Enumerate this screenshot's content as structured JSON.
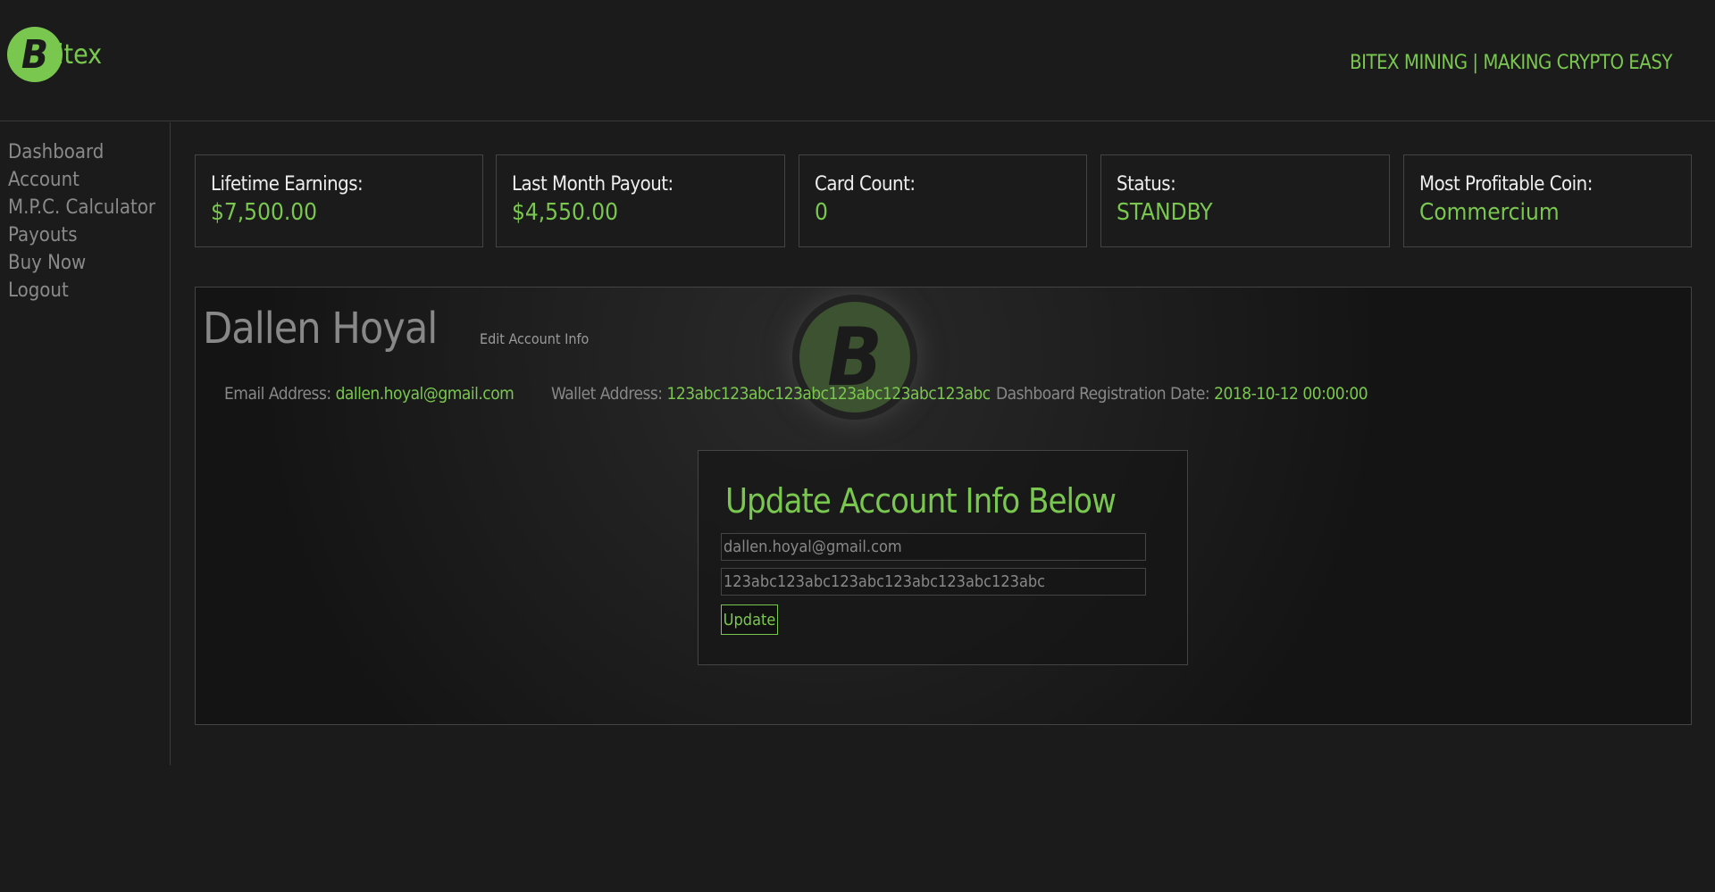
{
  "header": {
    "logo_text": "Bitex",
    "logo_letter": "B",
    "tagline": "BITEX MINING | MAKING CRYPTO EASY"
  },
  "sidebar": {
    "items": [
      {
        "label": "Dashboard"
      },
      {
        "label": "Account"
      },
      {
        "label": "M.P.C. Calculator"
      },
      {
        "label": "Payouts"
      },
      {
        "label": "Buy Now"
      },
      {
        "label": "Logout"
      }
    ]
  },
  "stats": [
    {
      "label": "Lifetime Earnings:",
      "value": "$7,500.00"
    },
    {
      "label": "Last Month Payout:",
      "value": "$4,550.00"
    },
    {
      "label": "Card Count:",
      "value": "0"
    },
    {
      "label": "Status:",
      "value": "STANDBY"
    },
    {
      "label": "Most Profitable Coin:",
      "value": "Commercium"
    }
  ],
  "profile": {
    "name": "Dallen Hoyal",
    "edit_link": "Edit Account Info",
    "email_label": "Email Address:",
    "email": "dallen.hoyal@gmail.com",
    "wallet_label": "Wallet Address:",
    "wallet": "123abc123abc123abc123abc123abc123abc",
    "reg_label": "Dashboard Registration Date:",
    "reg_date": "2018-10-12 00:00:00"
  },
  "form": {
    "title": "Update Account Info Below",
    "email_value": "dallen.hoyal@gmail.com",
    "wallet_value": "123abc123abc123abc123abc123abc123abc",
    "button": "Update"
  },
  "colors": {
    "accent": "#7ac74f",
    "background": "#1b1b1b"
  }
}
